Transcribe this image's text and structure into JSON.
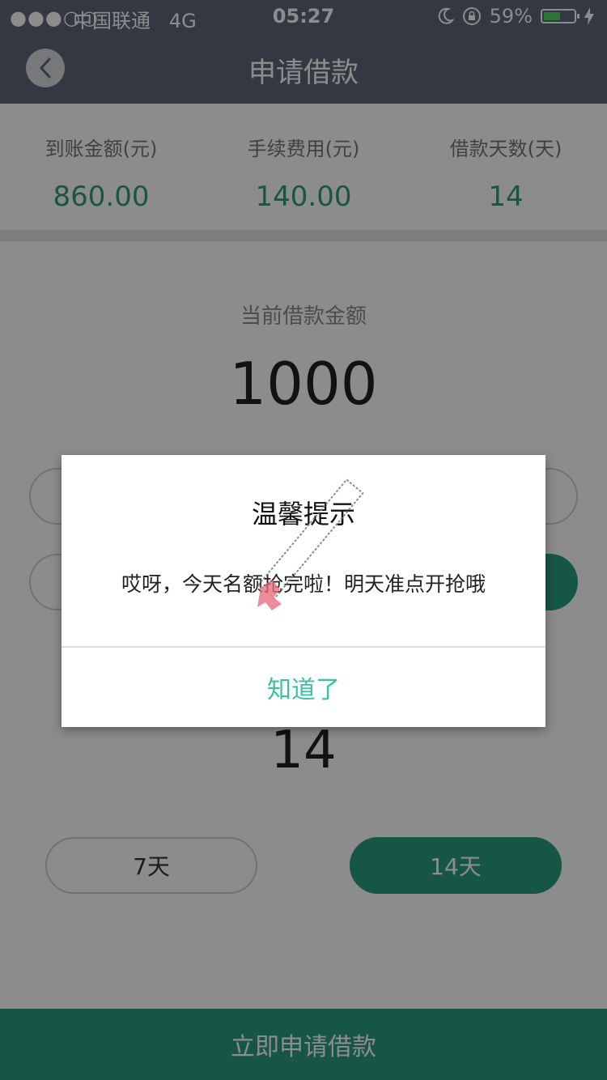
{
  "status_bar": {
    "signal": "●●●○○",
    "carrier": "中国联通",
    "network": "4G",
    "time": "05:27",
    "battery": "59%",
    "battery_level": 0.59
  },
  "nav": {
    "title": "申请借款"
  },
  "summary": {
    "items": [
      {
        "label": "到账金额(元)",
        "value": "860.00"
      },
      {
        "label": "手续费用(元)",
        "value": "140.00"
      },
      {
        "label": "借款天数(天)",
        "value": "14"
      }
    ]
  },
  "loan": {
    "amount_label": "当前借款金额",
    "amount_value": "1000",
    "days_value": "14",
    "day_options": [
      {
        "label": "7天",
        "active": false
      },
      {
        "label": "14天",
        "active": true
      }
    ]
  },
  "submit": {
    "label": "立即申请借款"
  },
  "dialog": {
    "title": "温馨提示",
    "message": "哎呀，今天名额抢完啦！明天准点开抢哦",
    "button": "知道了"
  },
  "colors": {
    "accent": "#2a9d82",
    "nav_bg": "#5e677a",
    "dialog_button": "#3cc0a2"
  }
}
